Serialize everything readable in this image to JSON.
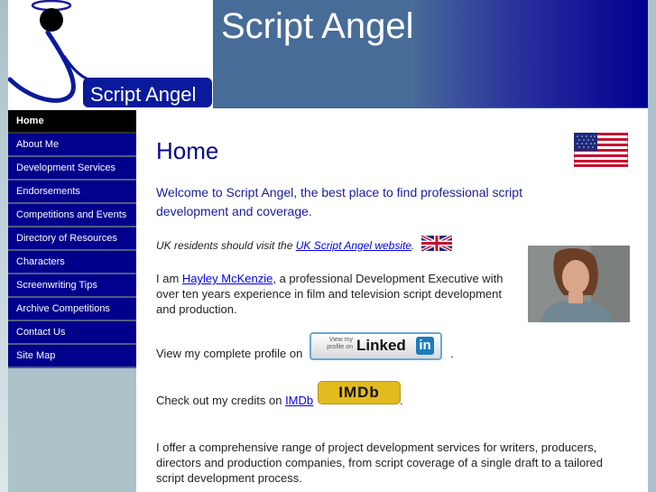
{
  "header": {
    "logo_text": "Script Angel",
    "banner_title": "Script Angel"
  },
  "nav": {
    "items": [
      {
        "label": "Home",
        "active": true
      },
      {
        "label": "About Me"
      },
      {
        "label": "Development Services"
      },
      {
        "label": "Endorsements"
      },
      {
        "label": "Competitions and Events"
      },
      {
        "label": "Directory of Resources"
      },
      {
        "label": "Characters"
      },
      {
        "label": "Screenwriting Tips"
      },
      {
        "label": "Archive Competitions"
      },
      {
        "label": "Contact Us"
      },
      {
        "label": "Site Map"
      }
    ]
  },
  "main": {
    "title": "Home",
    "welcome": "Welcome to Script Angel, the best place to find professional script development and coverage.",
    "uk_note_prefix": "UK residents should visit the ",
    "uk_link": "UK Script Angel website",
    "uk_note_suffix": ".",
    "intro_prefix": "I am ",
    "intro_link": "Hayley McKenzie",
    "intro_suffix": ", a professional Development Executive with over ten years experience in film and television script development and production.",
    "linkedin_text": "View my complete profile on",
    "linkedin_badge_small": "View my profile on",
    "linkedin_badge_big": "Linked",
    "linkedin_badge_in": "in",
    "linkedin_suffix": ".",
    "imdb_text": "Check out my credits on ",
    "imdb_link": "IMDb",
    "imdb_badge": "IMDb",
    "imdb_suffix": ".",
    "services": "I offer a comprehensive range of project development services for writers, producers, directors and production companies, from script coverage of a single draft to a tailored script development process."
  },
  "colors": {
    "nav_bg": "#00008d",
    "nav_active_bg": "#000000",
    "title_color": "#0a0a8c",
    "link_color": "#0000ee"
  }
}
